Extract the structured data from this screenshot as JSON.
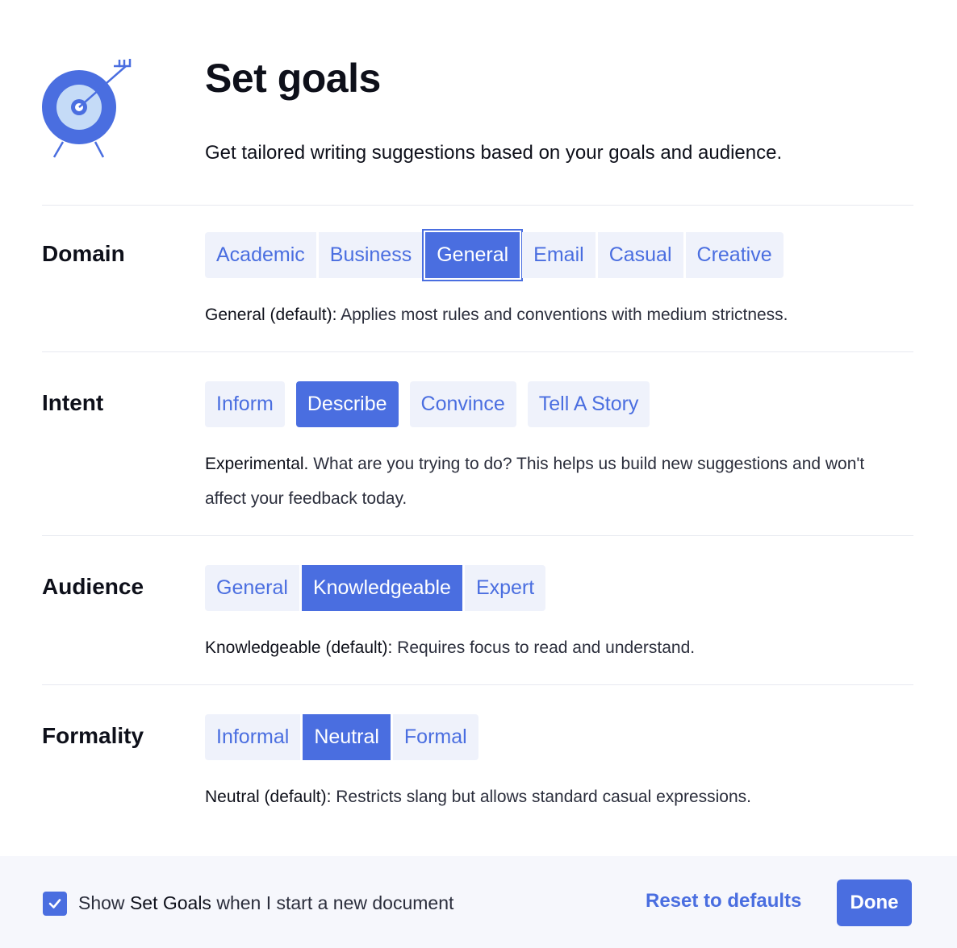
{
  "header": {
    "title": "Set goals",
    "subtitle": "Get tailored writing suggestions based on your goals and audience."
  },
  "domain": {
    "label": "Domain",
    "options": [
      "Academic",
      "Business",
      "General",
      "Email",
      "Casual",
      "Creative"
    ],
    "selected": "General",
    "desc_lead": "General (default):",
    "desc_text": "Applies most rules and conventions with medium strictness."
  },
  "intent": {
    "label": "Intent",
    "options": [
      "Inform",
      "Describe",
      "Convince",
      "Tell A Story"
    ],
    "selected": "Describe",
    "desc_lead": "Experimental.",
    "desc_text": "What are you trying to do? This helps us build new suggestions and won't affect your feedback today."
  },
  "audience": {
    "label": "Audience",
    "options": [
      "General",
      "Knowledgeable",
      "Expert"
    ],
    "selected": "Knowledgeable",
    "desc_lead": "Knowledgeable (default):",
    "desc_text": "Requires focus to read and understand."
  },
  "formality": {
    "label": "Formality",
    "options": [
      "Informal",
      "Neutral",
      "Formal"
    ],
    "selected": "Neutral",
    "desc_lead": "Neutral (default):",
    "desc_text": "Restricts slang but allows standard casual expressions."
  },
  "footer": {
    "checkbox_checked": true,
    "checkbox_label_pre": "Show",
    "checkbox_label_strong": "Set Goals",
    "checkbox_label_post": "when I start a new document",
    "reset_label": "Reset to defaults",
    "done_label": "Done"
  },
  "colors": {
    "accent": "#4a6ee0",
    "option_bg": "#eff2fb",
    "footer_bg": "#f6f7fc",
    "icon_light": "#c5dbf7"
  }
}
